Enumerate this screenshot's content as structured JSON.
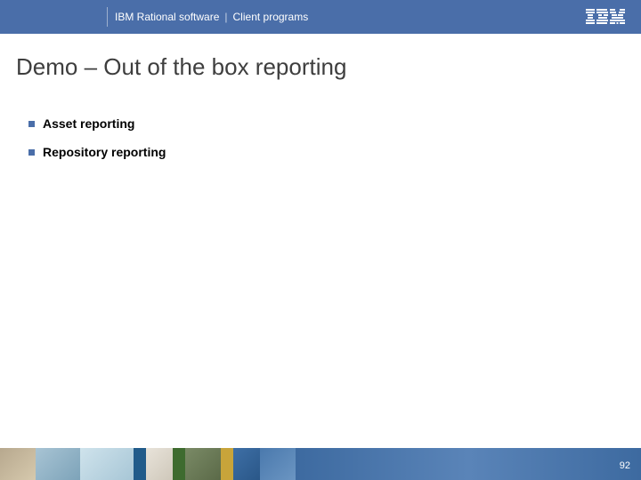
{
  "header": {
    "brand": "IBM Rational software",
    "section": "Client programs",
    "separator": "|"
  },
  "slide": {
    "title": "Demo – Out of the box reporting",
    "bullets": [
      "Asset reporting",
      "Repository reporting"
    ]
  },
  "footer": {
    "page_number": "92"
  }
}
